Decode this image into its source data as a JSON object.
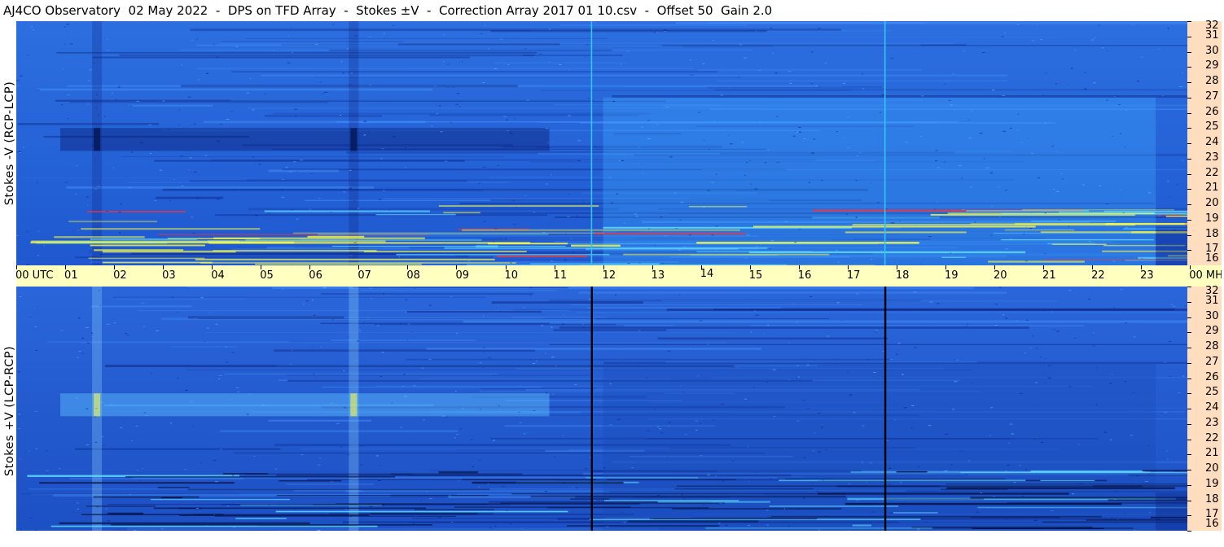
{
  "title": "AJ4CO Observatory  02 May 2022  -  DPS on TFD Array  -  Stokes ±V  -  Correction Array 2017 01 10.csv  -  Offset 50  Gain 2.0",
  "chart_data": [
    {
      "type": "heatmap",
      "panel": "top",
      "ylabel": "Stokes -V (RCP-LCP)",
      "x_ticks": [
        "00",
        "01",
        "02",
        "03",
        "04",
        "05",
        "06",
        "07",
        "08",
        "09",
        "10",
        "11",
        "12",
        "13",
        "14",
        "15",
        "16",
        "17",
        "18",
        "19",
        "20",
        "21",
        "22",
        "23",
        "00"
      ],
      "x_unit": "UTC",
      "y_ticks": [
        32,
        31,
        30,
        29,
        28,
        27,
        26,
        25,
        24,
        23,
        22,
        21,
        20,
        19,
        18,
        17,
        16
      ],
      "y_unit": "MHz",
      "xlim": [
        0,
        24
      ],
      "ylim": [
        16,
        32
      ],
      "event_lines_utc": [
        11.75,
        17.75
      ],
      "event_line_color": "#2fc6f0",
      "colors": {
        "low": "#0a1f7a",
        "mid": "#2f7ef0",
        "high": "#ffff40",
        "peak": "#ff3030"
      }
    },
    {
      "type": "heatmap",
      "panel": "bottom",
      "ylabel": "Stokes +V (LCP-RCP)",
      "x_ticks": [
        "00",
        "01",
        "02",
        "03",
        "04",
        "05",
        "06",
        "07",
        "08",
        "09",
        "10",
        "11",
        "12",
        "13",
        "14",
        "15",
        "16",
        "17",
        "18",
        "19",
        "20",
        "21",
        "22",
        "23",
        "00"
      ],
      "x_unit": "UTC",
      "y_ticks": [
        32,
        31,
        30,
        29,
        28,
        27,
        26,
        25,
        24,
        23,
        22,
        21,
        20,
        19,
        18,
        17,
        16
      ],
      "y_unit": "MHz",
      "xlim": [
        0,
        24
      ],
      "ylim": [
        16,
        32
      ],
      "event_lines_utc": [
        11.75,
        17.75
      ],
      "event_line_color": "#000000",
      "colors": {
        "low": "#0a1f7a",
        "mid": "#2f7ef0",
        "high": "#ffff40",
        "peak": "#ff3030"
      }
    }
  ]
}
